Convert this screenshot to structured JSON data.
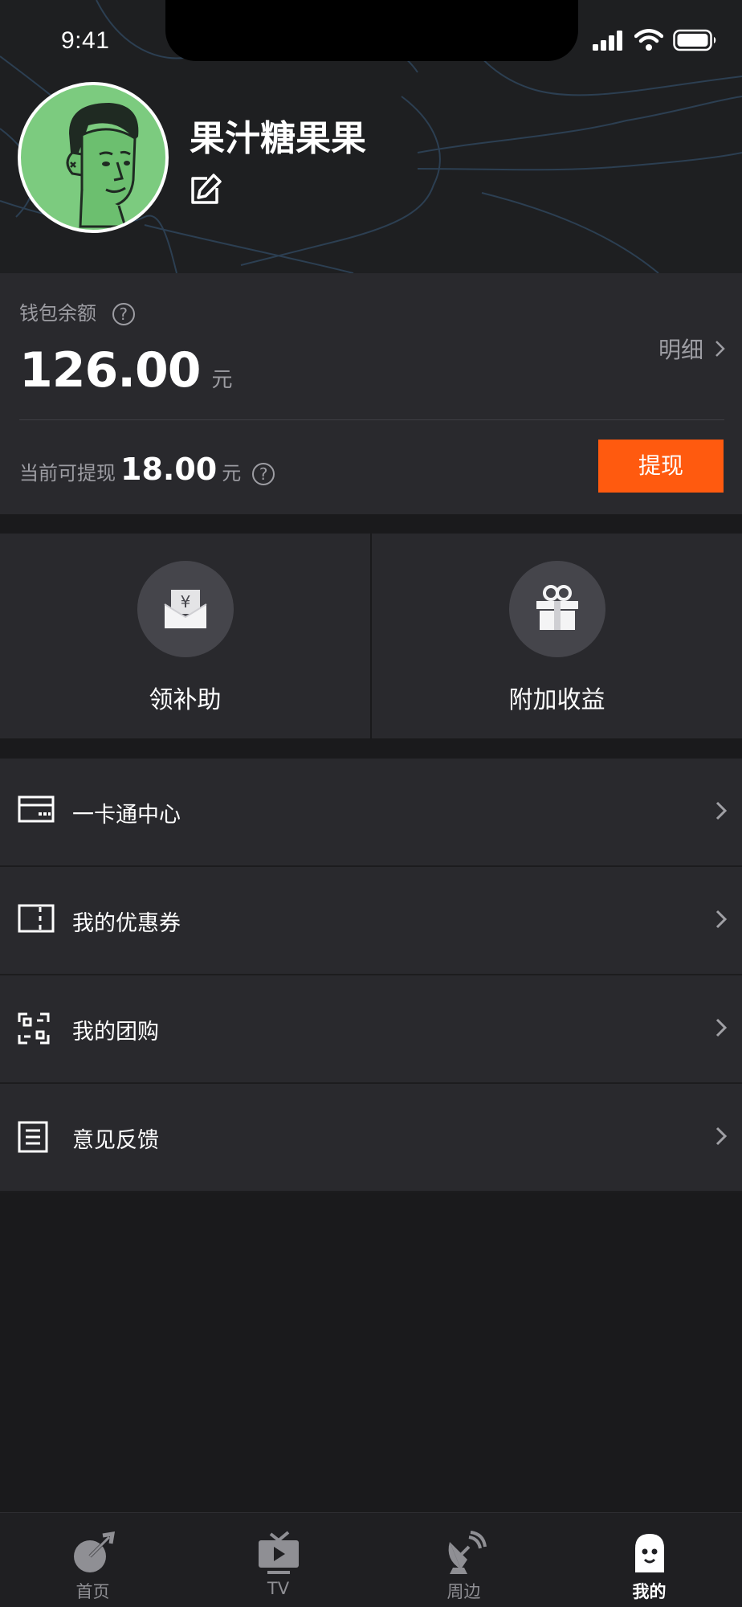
{
  "status_bar": {
    "time": "9:41"
  },
  "profile": {
    "username": "果汁糖果果"
  },
  "wallet": {
    "label": "钱包余额",
    "balance": "126.00",
    "unit": "元",
    "detail_label": "明细",
    "withdrawable_label": "当前可提现",
    "withdrawable_amount": "18.00",
    "withdrawable_unit": "元",
    "withdraw_button": "提现",
    "accent_color": "#ff5a0f"
  },
  "features": [
    {
      "label": "领补助",
      "icon": "red-envelope-icon"
    },
    {
      "label": "附加收益",
      "icon": "gift-box-icon"
    }
  ],
  "menu": [
    {
      "label": "一卡通中心",
      "icon": "card-icon"
    },
    {
      "label": "我的优惠券",
      "icon": "coupon-icon"
    },
    {
      "label": "我的团购",
      "icon": "scan-frame-icon"
    },
    {
      "label": "意见反馈",
      "icon": "document-icon"
    }
  ],
  "tabbar": [
    {
      "label": "首页",
      "icon": "dart-icon",
      "active": false
    },
    {
      "label": "TV",
      "icon": "tv-icon",
      "active": false
    },
    {
      "label": "周边",
      "icon": "satellite-dish-icon",
      "active": false
    },
    {
      "label": "我的",
      "icon": "ghost-face-icon",
      "active": true
    }
  ]
}
